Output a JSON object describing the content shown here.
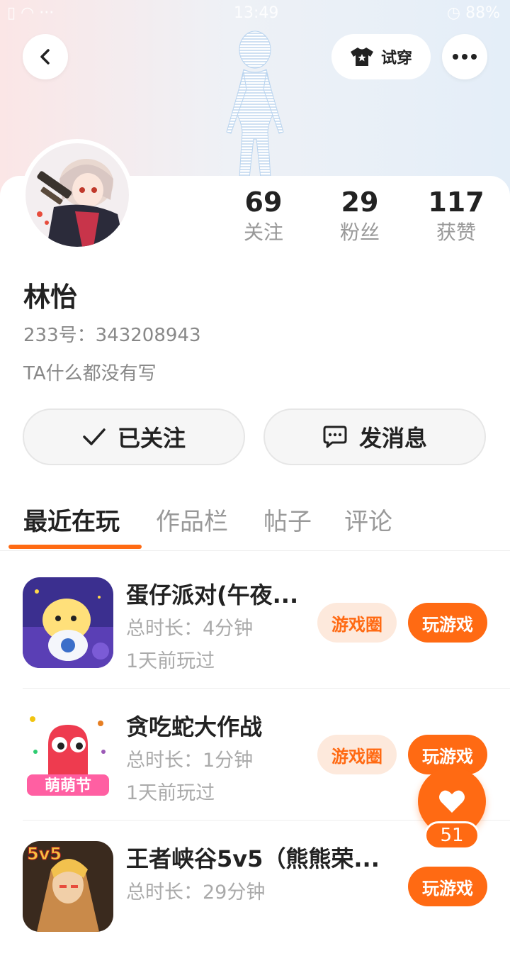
{
  "status_bar": {
    "left": "▯ ◠ ···",
    "time": "13:49",
    "battery": "◷ 88%"
  },
  "header": {
    "back_icon": "back-arrow-icon",
    "tryon_label": "试穿",
    "tryon_icon": "shirt-icon",
    "more_icon": "more-dots-icon"
  },
  "profile": {
    "name": "林怡",
    "uid": "233号：343208943",
    "bio": "TA什么都没有写",
    "stats": [
      {
        "value": "69",
        "label": "关注"
      },
      {
        "value": "29",
        "label": "粉丝"
      },
      {
        "value": "117",
        "label": "获赞"
      }
    ]
  },
  "actions": {
    "follow_label": "已关注",
    "message_label": "发消息"
  },
  "tabs": [
    {
      "label": "最近在玩",
      "active": true
    },
    {
      "label": "作品栏",
      "active": false
    },
    {
      "label": "帖子",
      "active": false
    },
    {
      "label": "评论",
      "active": false
    }
  ],
  "games": [
    {
      "title": "蛋仔派对(午夜...",
      "duration": "总时长：4分钟",
      "last_played": "1天前玩过",
      "circle_label": "游戏圈",
      "play_label": "玩游戏"
    },
    {
      "title": "贪吃蛇大作战",
      "duration": "总时长：1分钟",
      "last_played": "1天前玩过",
      "circle_label": "游戏圈",
      "play_label": "玩游戏",
      "icon_text": "萌萌节"
    },
    {
      "title": "王者峡谷5v5（熊熊荣...",
      "duration": "总时长：29分钟",
      "last_played": "",
      "circle_label": "",
      "play_label": "玩游戏",
      "icon_text": "5v5"
    }
  ],
  "like": {
    "count": "51"
  },
  "colors": {
    "accent": "#ff6a13",
    "accent_light": "#fde9dc"
  }
}
